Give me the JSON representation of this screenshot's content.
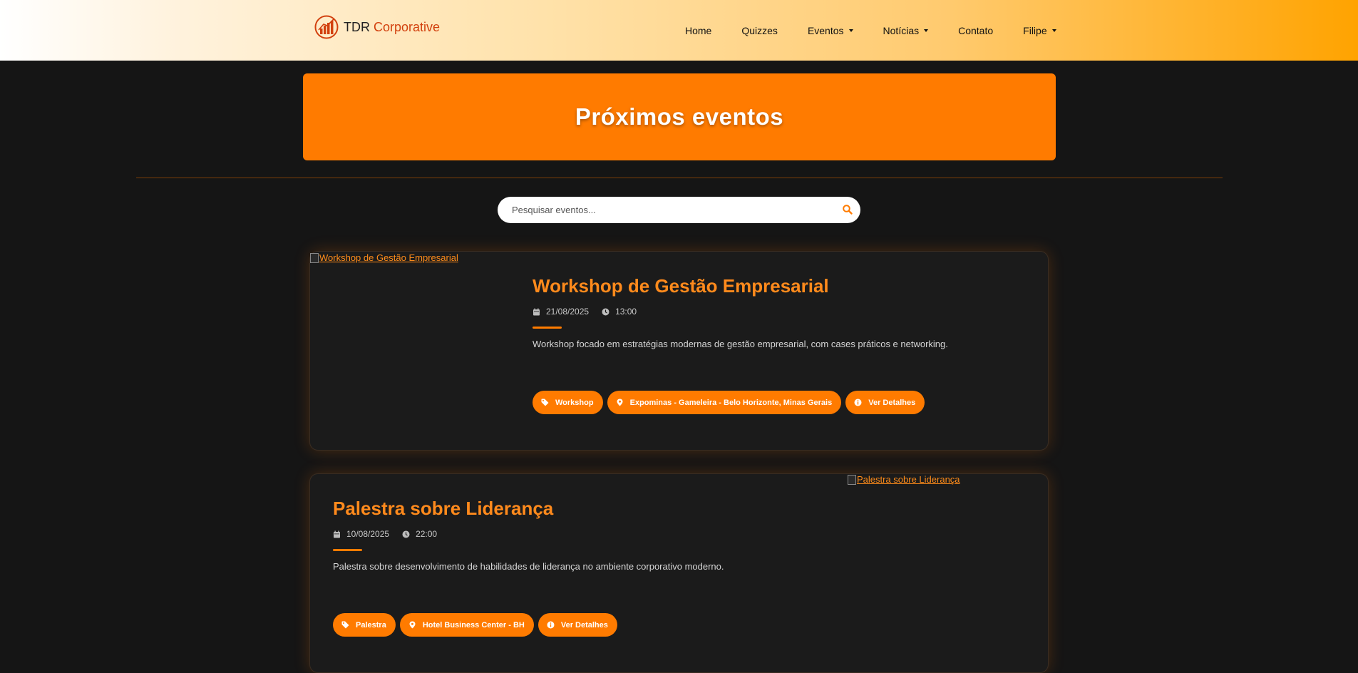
{
  "navbar": {
    "brand_main": "TDR",
    "brand_accent": "Corporative",
    "links": [
      {
        "label": "Home",
        "dropdown": false
      },
      {
        "label": "Quizzes",
        "dropdown": false
      },
      {
        "label": "Eventos",
        "dropdown": true
      },
      {
        "label": "Notícias",
        "dropdown": true
      },
      {
        "label": "Contato",
        "dropdown": false
      },
      {
        "label": "Filipe",
        "dropdown": true
      }
    ]
  },
  "hero": {
    "title": "Próximos eventos"
  },
  "search": {
    "placeholder": "Pesquisar eventos...",
    "icon": "search-icon"
  },
  "events": [
    {
      "image_alt": "Workshop de Gestão Empresarial",
      "title": "Workshop de Gestão Empresarial",
      "date": "21/08/2025",
      "time": "13:00",
      "description": "Workshop focado em estratégias modernas de gestão empresarial, com cases práticos e networking.",
      "category": "Workshop",
      "location": "Expominas - Gameleira - Belo Horizonte, Minas Gerais",
      "details_label": "Ver Detalhes"
    },
    {
      "image_alt": "Palestra sobre Liderança",
      "title": "Palestra sobre Liderança",
      "date": "10/08/2025",
      "time": "22:00",
      "description": "Palestra sobre desenvolvimento de habilidades de liderança no ambiente corporativo moderno.",
      "category": "Palestra",
      "location": "Hotel Business Center - BH",
      "details_label": "Ver Detalhes"
    }
  ],
  "colors": {
    "accent": "#ff7b00",
    "title_orange": "#ff8a1c",
    "background": "#151515",
    "card": "#1b1b1b"
  }
}
